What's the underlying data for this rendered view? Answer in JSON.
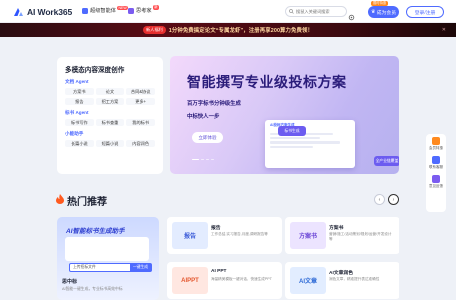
{
  "header": {
    "logo_text": "AI Work365",
    "nav": [
      {
        "label": "超级智能体",
        "badge": "NEW",
        "color": "#4f6bff"
      },
      {
        "label": "思考家",
        "badge": "新",
        "color": "#7b5cf0"
      }
    ],
    "search_placeholder": "搜鼠入关键词搜索",
    "member_tag": "限时特惠",
    "member_label": "成为会员",
    "login_label": "登录/注册"
  },
  "banner": {
    "pill": "新人福利",
    "text": "1分钟免费搞定论文“专属龙虾”，注册再享200算力免费领！",
    "close": "✕"
  },
  "left_panel": {
    "title": "多模态内容深度创作",
    "sections": [
      {
        "label": "文档 Agent",
        "items": [
          "方案书",
          "论文",
          "合同&协议",
          "报告",
          "招工方案",
          "更多+"
        ]
      },
      {
        "label": "标书 Agent",
        "items": [
          "标书写作",
          "标书查重",
          "我的标书"
        ]
      },
      {
        "label": "小能助手",
        "items": [
          "长篇小说",
          "短篇小说",
          "内容润色"
        ]
      }
    ]
  },
  "hero": {
    "title": "智能撰写专业级投标方案",
    "subtitle": "百万字标书分钟级生成",
    "subtitle2": "中标快人一步",
    "button": "立即体验",
    "mock_head": "AI投标方案生成",
    "mock_card": "标书生成",
    "mock_card2": "全产业链覆盖"
  },
  "side_bar": [
    {
      "label": "会员特惠",
      "color": "#ff8a1f"
    },
    {
      "label": "联系客服",
      "color": "#4f6bff"
    },
    {
      "label": "意见反馈",
      "color": "#7b5cf0"
    }
  ],
  "hot": {
    "title": "热门推荐",
    "prev": "‹",
    "next": "›"
  },
  "featured": {
    "title": "AI智能标书生成助手",
    "upload_hint": "上传招标文件",
    "upload_btn": "一键生成",
    "name": "思中标",
    "desc": "AI智能一键生成，专业标书高效中标"
  },
  "tiles": [
    {
      "thumb": "报告",
      "name": "报告",
      "desc": "工作总结,实习报告,月度,调研报告等",
      "bg": "#e3ecff",
      "fg": "#3b5bd8"
    },
    {
      "thumb": "方案书",
      "name": "方案书",
      "desc": "营销/施工/活动策划/规划/运营/开发设计等",
      "bg": "#ece4ff",
      "fg": "#6a45d6"
    },
    {
      "thumb": "AIPPT",
      "name": "AI PPT",
      "desc": "海量精美模板一键对话，快速生成PPT",
      "bg": "#ffe7e1",
      "fg": "#e4572e"
    },
    {
      "thumb": "AI文章",
      "name": "AI文章润色",
      "desc": "润色文章，精准提升表达准确性",
      "bg": "#e2edff",
      "fg": "#2e6ad6"
    }
  ]
}
